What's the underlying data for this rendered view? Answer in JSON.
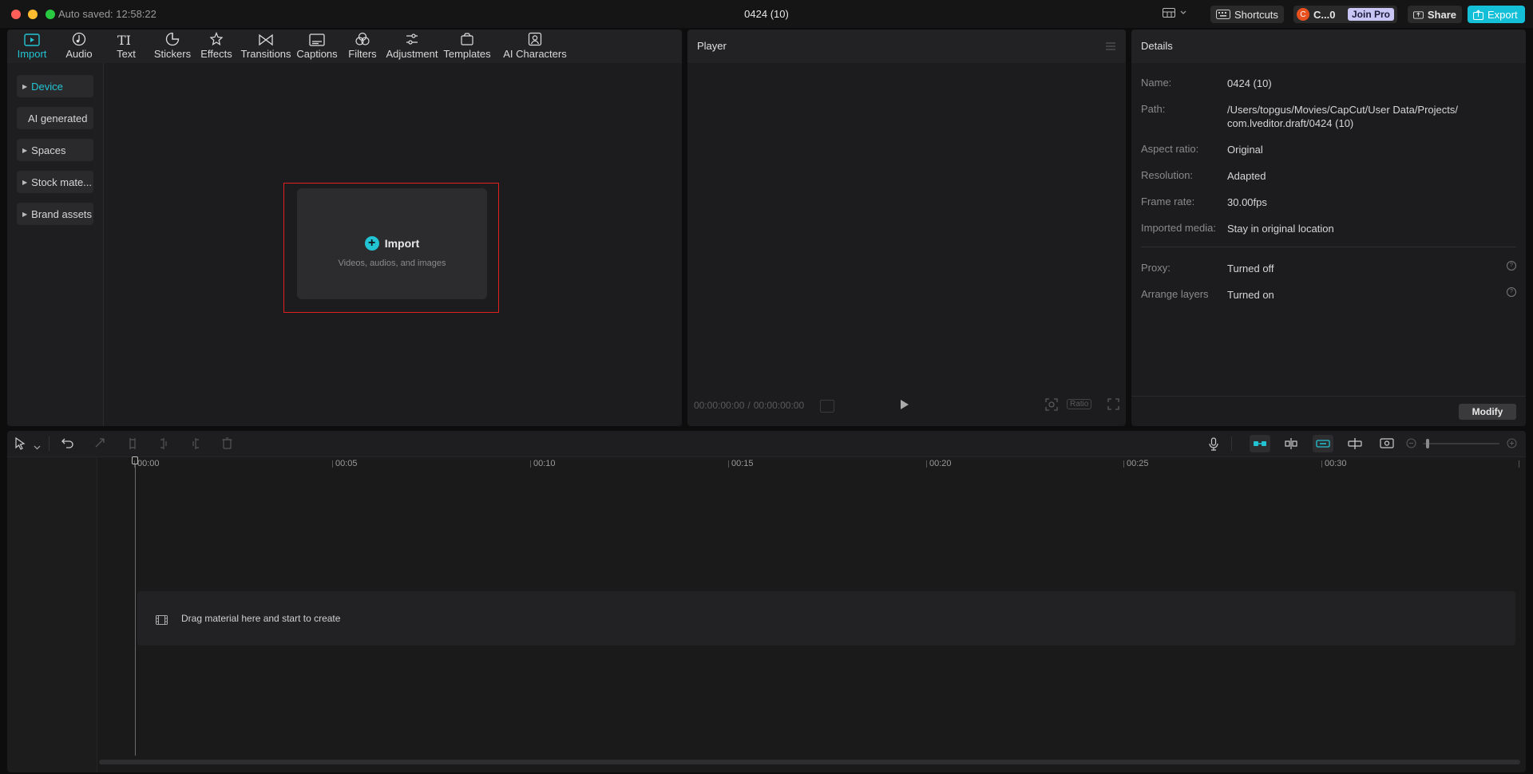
{
  "window": {
    "title": "0424 (10)",
    "autosave": "Auto saved: 12:58:22"
  },
  "topbar": {
    "shortcuts": "Shortcuts",
    "user": "C...0",
    "user_initial": "C",
    "join_pro": "Join Pro",
    "share": "Share",
    "export": "Export"
  },
  "toolbar": {
    "tabs": [
      "Import",
      "Audio",
      "Text",
      "Stickers",
      "Effects",
      "Transitions",
      "Captions",
      "Filters",
      "Adjustment",
      "Templates",
      "AI Characters"
    ]
  },
  "sidebar": {
    "items": [
      "Device",
      "AI generated",
      "Spaces",
      "Stock mate...",
      "Brand assets"
    ]
  },
  "import_box": {
    "title": "Import",
    "subtitle": "Videos, audios, and images"
  },
  "player": {
    "title": "Player",
    "time_current": "00:00:00:00",
    "time_sep": "/",
    "time_total": "00:00:00:00",
    "ratio": "Ratio"
  },
  "details": {
    "title": "Details",
    "rows": [
      {
        "label": "Name:",
        "value": "0424 (10)"
      },
      {
        "label": "Path:",
        "value1": "/Users/topgus/Movies/CapCut/User Data/Projects/",
        "value2": "com.lveditor.draft/0424 (10)"
      },
      {
        "label": "Aspect ratio:",
        "value": "Original"
      },
      {
        "label": "Resolution:",
        "value": "Adapted"
      },
      {
        "label": "Frame rate:",
        "value": "30.00fps"
      },
      {
        "label": "Imported media:",
        "value": "Stay in original location"
      },
      {
        "label": "Proxy:",
        "value": "Turned off"
      },
      {
        "label": "Arrange layers",
        "value": "Turned on"
      }
    ],
    "modify": "Modify"
  },
  "timeline": {
    "ticks": [
      "00:00",
      "00:05",
      "00:10",
      "00:15",
      "00:20",
      "00:25",
      "00:30"
    ],
    "drop_hint": "Drag material here and start to create"
  },
  "colors": {
    "accent": "#22c4d4",
    "export_bg": "#14c0d8",
    "join_pro_bg": "#c9c6f5",
    "highlight_border": "#e02020"
  }
}
